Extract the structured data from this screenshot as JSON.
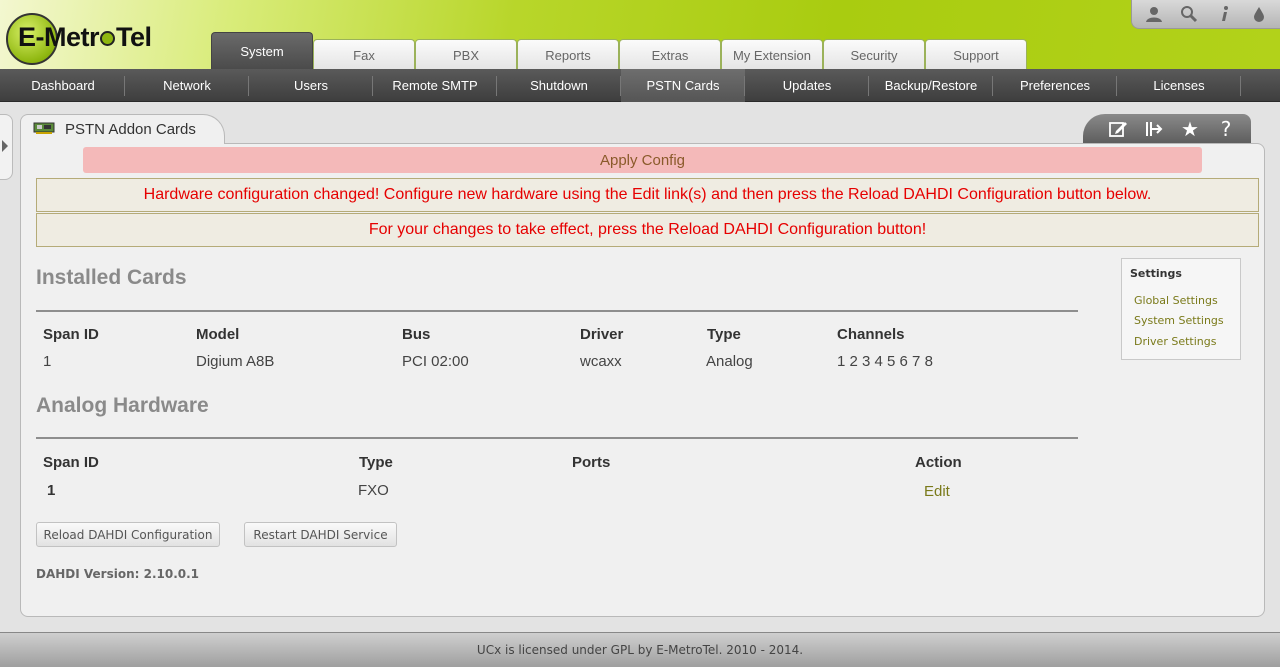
{
  "logo": {
    "text_pre": "E-Metr",
    "text_post": "Tel"
  },
  "top_tabs": [
    "System",
    "Fax",
    "PBX",
    "Reports",
    "Extras",
    "My Extension",
    "Security",
    "Support"
  ],
  "top_tabs_active": 0,
  "sub_nav": [
    "Dashboard",
    "Network",
    "Users",
    "Remote SMTP",
    "Shutdown",
    "PSTN Cards",
    "Updates",
    "Backup/Restore",
    "Preferences",
    "Licenses"
  ],
  "sub_nav_active": 5,
  "header_icons": [
    "user-icon",
    "search-icon",
    "info-icon",
    "drop-icon"
  ],
  "page": {
    "title": "PSTN Addon Cards",
    "title_icon": "pci-card-icon",
    "tool_icons": [
      "edit-icon",
      "export-icon",
      "star-icon",
      "help-icon"
    ]
  },
  "apply_config": "Apply Config",
  "messages": [
    "Hardware configuration changed! Configure new hardware using the Edit link(s) and then press the Reload DAHDI Configuration button below.",
    "For your changes to take effect, press the Reload DAHDI Configuration button!"
  ],
  "installed_cards": {
    "heading": "Installed Cards",
    "headers": [
      "Span ID",
      "Model",
      "Bus",
      "Driver",
      "Type",
      "Channels"
    ],
    "rows": [
      [
        "1",
        "Digium A8B",
        "PCI 02:00",
        "wcaxx",
        "Analog",
        "1 2 3 4 5 6 7 8"
      ]
    ]
  },
  "analog_hardware": {
    "heading": "Analog Hardware",
    "headers": [
      "Span ID",
      "Type",
      "Ports",
      "Action"
    ],
    "rows": [
      [
        "1",
        "FXO",
        "",
        "Edit"
      ]
    ]
  },
  "buttons": {
    "reload": "Reload DAHDI Configuration",
    "restart": "Restart DAHDI Service"
  },
  "dahdi_version": "DAHDI Version: 2.10.0.1",
  "settings": {
    "title": "Settings",
    "links": [
      "Global Settings",
      "System Settings",
      "Driver Settings"
    ]
  },
  "footer": "UCx is licensed under GPL by E-MetroTel. 2010 - 2014.",
  "colors": {
    "accent_green": "#a9cc10",
    "error_red": "#e60000",
    "apply_bg": "#f4b9b9",
    "link_olive": "#7a7a1a"
  }
}
